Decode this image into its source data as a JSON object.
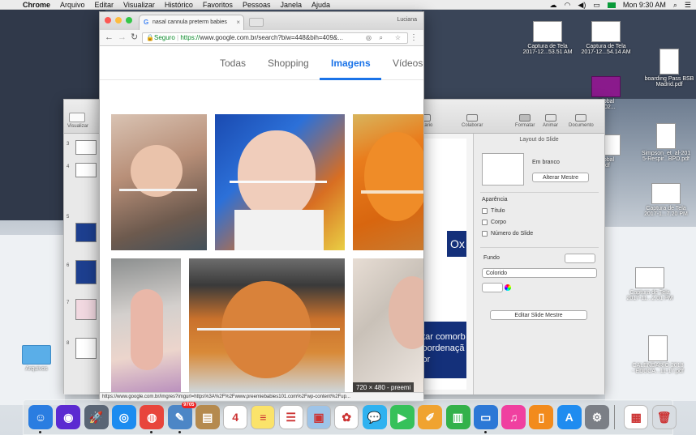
{
  "menubar": {
    "apple": "",
    "app_name": "Chrome",
    "items": [
      "Arquivo",
      "Editar",
      "Visualizar",
      "Histórico",
      "Favoritos",
      "Pessoas",
      "Janela",
      "Ajuda"
    ],
    "clock": "Mon 9:30 AM"
  },
  "desktop_icons": [
    {
      "label": "Captura de Tela\n2017-12...53.51 AM",
      "kind": "screenshot"
    },
    {
      "label": "Captura de Tela\n2017-12...54.14 AM",
      "kind": "screenshot"
    },
    {
      "label": "boarding Pass BSB\nMadrid.pdf",
      "kind": "pdf"
    },
    {
      "label": "Global\n2 102...",
      "kind": "purple"
    },
    {
      "label": "Global\npdf",
      "kind": "screenshot"
    },
    {
      "label": "Simpson_et_al-201\n5-Respir...BPD.pdf",
      "kind": "pdf"
    },
    {
      "label": "Captura de Tela\n2017-1...7.20 PM",
      "kind": "screenshot"
    },
    {
      "label": "Captura de Tela\n2017-11...2.01 PM",
      "kind": "screenshot"
    },
    {
      "label": "CALENDARIO 2018\n- EDUCA...11-17.pdf",
      "kind": "pdf"
    },
    {
      "label": "Arquivos",
      "kind": "folder"
    }
  ],
  "keynote": {
    "sidebar_label": "Visualizar",
    "tools": [
      "entario",
      "Colaborar",
      "Formatar",
      "Animar",
      "Documento"
    ],
    "slide_numbers": [
      "3",
      "4",
      "5",
      "6",
      "7",
      "8"
    ],
    "slide_text_1": "Ox",
    "slide_text_2": "atar comorb coordenaçã cor",
    "inspector": {
      "title": "Layout do Slide",
      "layout_name": "Em branco",
      "change_master": "Alterar Mestre",
      "appearance": "Aparência",
      "checks": [
        "Título",
        "Corpo",
        "Número do Slide"
      ],
      "background_label": "Fundo",
      "background_fill": "Colorido",
      "edit_master": "Editar Slide Mestre"
    }
  },
  "chrome": {
    "tab_title": "nasal cannula preterm babies",
    "profile": "Luciana",
    "omnibox": {
      "secure_label": "Seguro",
      "scheme": "https://",
      "url": "www.google.com.br/search?biw=448&bih=409&..."
    },
    "search_tabs": [
      "Todas",
      "Shopping",
      "Imagens",
      "Vídeos"
    ],
    "active_tab": "Imagens",
    "image_badge": "720 × 480 - preemi",
    "status_url": "https://www.google.com.br/imgres?imgurl=https%3A%2F%2Fwww.preemiebabies101.com%2Fwp-content%2Fup..."
  },
  "dock": {
    "apps": [
      {
        "name": "Finder",
        "color": "#2a7de1",
        "glyph": "☺"
      },
      {
        "name": "Siri",
        "color": "#5b2ad1",
        "glyph": "◉"
      },
      {
        "name": "Launchpad",
        "color": "#596575",
        "glyph": "🚀"
      },
      {
        "name": "Safari",
        "color": "#1c8cf0",
        "glyph": "◎"
      },
      {
        "name": "Chrome",
        "color": "#e8453c",
        "glyph": "◍"
      },
      {
        "name": "Preview",
        "color": "#4c86c6",
        "glyph": "✎",
        "badge": "9705"
      },
      {
        "name": "Notes-brown",
        "color": "#b58a4e",
        "glyph": "▤"
      },
      {
        "name": "Calendar",
        "color": "#ffffff",
        "glyph": "4"
      },
      {
        "name": "Notes",
        "color": "#fbe36a",
        "glyph": "≡"
      },
      {
        "name": "Reminders",
        "color": "#ffffff",
        "glyph": "☰"
      },
      {
        "name": "Preview2",
        "color": "#9ec4e8",
        "glyph": "▣"
      },
      {
        "name": "Photos",
        "color": "#ffffff",
        "glyph": "✿"
      },
      {
        "name": "Messages",
        "color": "#2fb2f0",
        "glyph": "💬"
      },
      {
        "name": "FaceTime",
        "color": "#36c15a",
        "glyph": "▶"
      },
      {
        "name": "Pages",
        "color": "#f0a330",
        "glyph": "✐"
      },
      {
        "name": "Numbers",
        "color": "#33b14a",
        "glyph": "▥"
      },
      {
        "name": "Keynote",
        "color": "#2c78d6",
        "glyph": "▭"
      },
      {
        "name": "iTunes",
        "color": "#f040a0",
        "glyph": "♫"
      },
      {
        "name": "iBooks",
        "color": "#f28b1c",
        "glyph": "▯"
      },
      {
        "name": "App Store",
        "color": "#1f8cf0",
        "glyph": "A"
      },
      {
        "name": "System Preferences",
        "color": "#7b7f86",
        "glyph": "⚙"
      },
      {
        "name": "Document",
        "color": "#ffffff",
        "glyph": "▦"
      },
      {
        "name": "Trash",
        "color": "#d8dde2",
        "glyph": "🗑"
      }
    ]
  }
}
